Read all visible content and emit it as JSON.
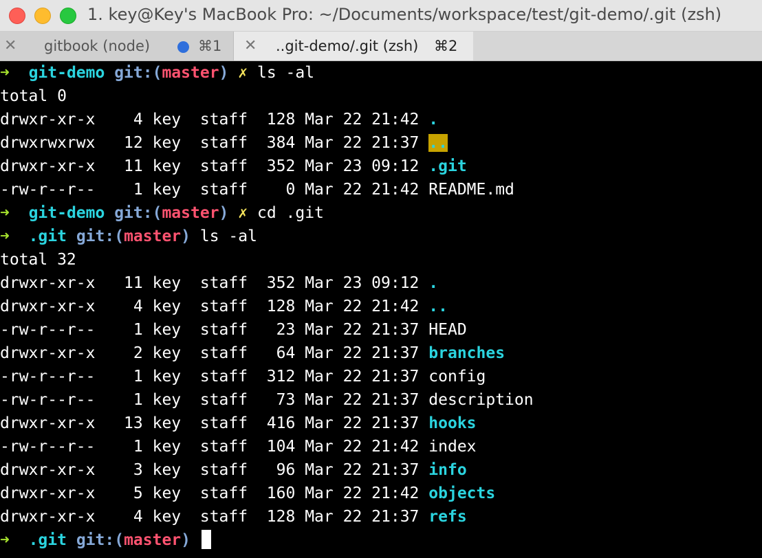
{
  "window": {
    "title": "1. key@Key's MacBook Pro: ~/Documents/workspace/test/git-demo/.git (zsh)",
    "colors": {
      "close": "#fe5f57",
      "minimize": "#febc2e",
      "maximize": "#28c840"
    }
  },
  "tabs": [
    {
      "close_glyph": "✕",
      "label": "gitbook (node)",
      "shortcut": "⌘1",
      "has_activity_dot": true
    },
    {
      "close_glyph": "✕",
      "label": "..git-demo/.git (zsh)",
      "shortcut": "⌘2",
      "active": true
    }
  ],
  "terminal": {
    "prompt1": {
      "arrow": "➜",
      "dir": "git-demo",
      "git_label": "git:(",
      "branch": "master",
      "git_close": ")",
      "dirty": "✗",
      "command": "ls -al"
    },
    "listing1": {
      "total": "total 0",
      "rows": [
        {
          "perms": "drwxr-xr-x",
          "links": "4",
          "owner": "key",
          "group": "staff",
          "size": "128",
          "month": "Mar",
          "day": "22",
          "time": "21:42",
          "name": "."
        },
        {
          "perms": "drwxrwxrwx",
          "links": "12",
          "owner": "key",
          "group": "staff",
          "size": "384",
          "month": "Mar",
          "day": "22",
          "time": "21:37",
          "name": ".."
        },
        {
          "perms": "drwxr-xr-x",
          "links": "11",
          "owner": "key",
          "group": "staff",
          "size": "352",
          "month": "Mar",
          "day": "23",
          "time": "09:12",
          "name": ".git"
        },
        {
          "perms": "-rw-r--r--",
          "links": "1",
          "owner": "key",
          "group": "staff",
          "size": "0",
          "month": "Mar",
          "day": "22",
          "time": "21:42",
          "name": "README.md"
        }
      ]
    },
    "prompt2": {
      "arrow": "➜",
      "dir": "git-demo",
      "git_label": "git:(",
      "branch": "master",
      "git_close": ")",
      "dirty": "✗",
      "command": "cd .git"
    },
    "prompt3": {
      "arrow": "➜",
      "dir": ".git",
      "git_label": "git:(",
      "branch": "master",
      "git_close": ")",
      "command": "ls -al"
    },
    "listing2": {
      "total": "total 32",
      "rows": [
        {
          "perms": "drwxr-xr-x",
          "links": "11",
          "owner": "key",
          "group": "staff",
          "size": "352",
          "month": "Mar",
          "day": "23",
          "time": "09:12",
          "name": "."
        },
        {
          "perms": "drwxr-xr-x",
          "links": "4",
          "owner": "key",
          "group": "staff",
          "size": "128",
          "month": "Mar",
          "day": "22",
          "time": "21:42",
          "name": ".."
        },
        {
          "perms": "-rw-r--r--",
          "links": "1",
          "owner": "key",
          "group": "staff",
          "size": "23",
          "month": "Mar",
          "day": "22",
          "time": "21:37",
          "name": "HEAD"
        },
        {
          "perms": "drwxr-xr-x",
          "links": "2",
          "owner": "key",
          "group": "staff",
          "size": "64",
          "month": "Mar",
          "day": "22",
          "time": "21:37",
          "name": "branches"
        },
        {
          "perms": "-rw-r--r--",
          "links": "1",
          "owner": "key",
          "group": "staff",
          "size": "312",
          "month": "Mar",
          "day": "22",
          "time": "21:37",
          "name": "config"
        },
        {
          "perms": "-rw-r--r--",
          "links": "1",
          "owner": "key",
          "group": "staff",
          "size": "73",
          "month": "Mar",
          "day": "22",
          "time": "21:37",
          "name": "description"
        },
        {
          "perms": "drwxr-xr-x",
          "links": "13",
          "owner": "key",
          "group": "staff",
          "size": "416",
          "month": "Mar",
          "day": "22",
          "time": "21:37",
          "name": "hooks"
        },
        {
          "perms": "-rw-r--r--",
          "links": "1",
          "owner": "key",
          "group": "staff",
          "size": "104",
          "month": "Mar",
          "day": "22",
          "time": "21:42",
          "name": "index"
        },
        {
          "perms": "drwxr-xr-x",
          "links": "3",
          "owner": "key",
          "group": "staff",
          "size": "96",
          "month": "Mar",
          "day": "22",
          "time": "21:37",
          "name": "info"
        },
        {
          "perms": "drwxr-xr-x",
          "links": "5",
          "owner": "key",
          "group": "staff",
          "size": "160",
          "month": "Mar",
          "day": "22",
          "time": "21:42",
          "name": "objects"
        },
        {
          "perms": "drwxr-xr-x",
          "links": "4",
          "owner": "key",
          "group": "staff",
          "size": "128",
          "month": "Mar",
          "day": "22",
          "time": "21:37",
          "name": "refs"
        }
      ]
    },
    "prompt4": {
      "arrow": "➜",
      "dir": ".git",
      "git_label": "git:(",
      "branch": "master",
      "git_close": ")"
    },
    "colors": {
      "arrow": "#a6e22e",
      "dir": "#2bd4df",
      "branch": "#ff5370",
      "dirty": "#f3e25b",
      "highlight": "#c7a300"
    }
  }
}
